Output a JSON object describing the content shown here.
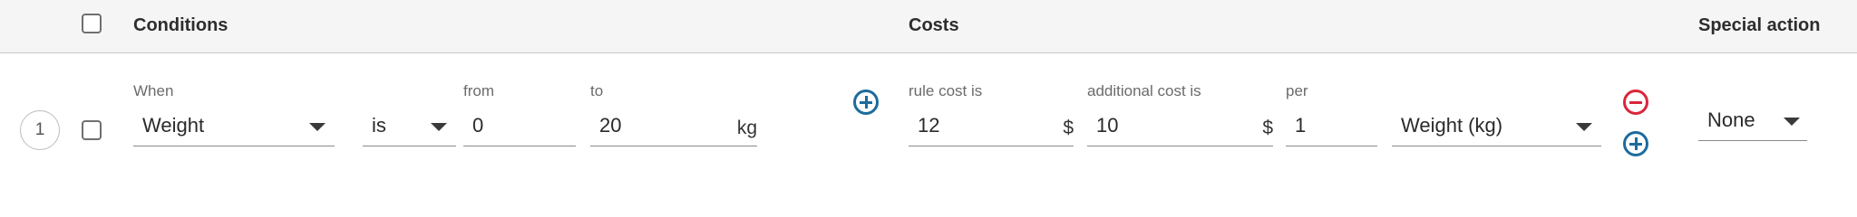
{
  "header": {
    "conditions": "Conditions",
    "costs": "Costs",
    "special_action": "Special action"
  },
  "row": {
    "number": "1",
    "when_label": "When",
    "when_value": "Weight",
    "operator_value": "is",
    "from_label": "from",
    "from_value": "0",
    "to_label": "to",
    "to_value": "20",
    "unit": "kg",
    "rule_cost_label": "rule cost is",
    "rule_cost_value": "12",
    "rule_cost_currency": "$",
    "additional_cost_label": "additional cost is",
    "additional_cost_value": "10",
    "additional_cost_currency": "$",
    "per_label": "per",
    "per_value": "1",
    "per_unit_value": "Weight (kg)",
    "special_action_value": "None"
  },
  "icons": {
    "add_condition": "plus-circle-icon",
    "remove_row": "minus-circle-icon",
    "add_row": "plus-circle-icon"
  },
  "colors": {
    "accent_blue": "#1c6c9c",
    "danger_red": "#d9263b",
    "header_bg": "#f5f5f5"
  }
}
